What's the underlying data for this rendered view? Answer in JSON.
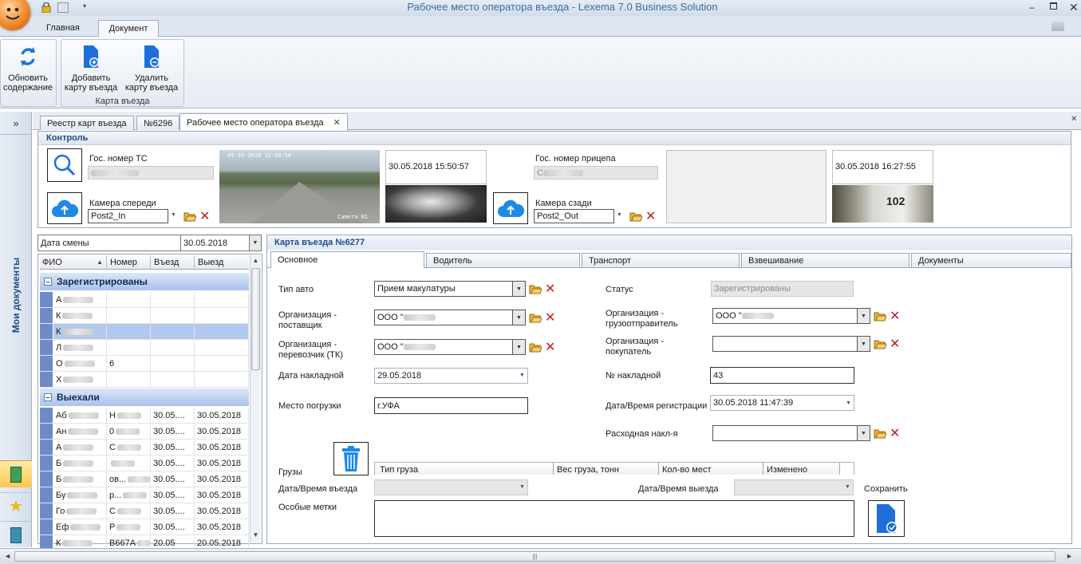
{
  "window": {
    "title": "Рабочее место оператора въезда - Lexema 7.0 Business Solution"
  },
  "ribbon": {
    "tabs": [
      "Главная",
      "Документ"
    ],
    "refresh": [
      "Обновить",
      "содержание"
    ],
    "add_card": [
      "Добавить",
      "карту въезда"
    ],
    "del_card": [
      "Удалить",
      "карту въезда"
    ],
    "group": "Карта въезда"
  },
  "side": {
    "expand": "»",
    "label": "Мои документы"
  },
  "doc_tabs": [
    "Реестр карт въезда",
    "№6296",
    "Рабочее место оператора въезда"
  ],
  "control": {
    "header": "Контроль",
    "front_plate_label": "Гос. номер ТС",
    "front_cam_label": "Камера спереди",
    "front_cam_value": "Post2_In",
    "front_ts": "30.05.2018 15:50:57",
    "trailer_label": "Гос. номер прицепа",
    "trailer_value": "С",
    "rear_cam_label": "Камера сзади",
    "rear_cam_value": "Post2_Out",
    "rear_ts": "30.05.2018 16:27:55",
    "cam_overlay": "05-30-2018 15:50:58",
    "cam_name": "Camera 01",
    "plate_text": "102"
  },
  "shift": {
    "label": "Дата смены",
    "value": "30.05.2018"
  },
  "grid": {
    "columns": [
      "ФИО",
      "Номер",
      "Въезд",
      "Выезд"
    ],
    "groups": [
      {
        "name": "Зарегистрированы",
        "rows": [
          [
            "А",
            "",
            "",
            ""
          ],
          [
            "К",
            "",
            "",
            ""
          ],
          [
            "К",
            "",
            "",
            ""
          ],
          [
            "Л",
            "",
            "",
            ""
          ],
          [
            "О",
            "6",
            "",
            ""
          ],
          [
            "Х",
            "",
            "",
            ""
          ]
        ]
      },
      {
        "name": "Выехали",
        "rows": [
          [
            "Аб",
            "Н",
            "30.05....",
            "30.05.2018"
          ],
          [
            "Ан",
            "0",
            "30.05....",
            "30.05.2018"
          ],
          [
            "А",
            "С",
            "30.05....",
            "30.05.2018"
          ],
          [
            "Б",
            "",
            "30.05....",
            "30.05.2018"
          ],
          [
            "Б",
            "ов...",
            "30.05....",
            "30.05.2018"
          ],
          [
            "Бу",
            "р...",
            "30.05....",
            "30.05.2018"
          ],
          [
            "Го",
            "С",
            "30.05....",
            "30.05.2018"
          ],
          [
            "Еф",
            "Р",
            "30.05....",
            "30.05.2018"
          ],
          [
            "К",
            "В667А",
            "20.05",
            "20.05.2018"
          ]
        ]
      }
    ]
  },
  "card": {
    "header": "Карта въезда №6277",
    "tabs": [
      "Основное",
      "Водитель",
      "Транспорт",
      "Взвешивание",
      "Документы"
    ],
    "auto_type_label": "Тип авто",
    "auto_type_value": "Прием макулатуры",
    "status_label": "Статус",
    "status_value": "Зарегистрированы",
    "supplier_label": [
      "Организация -",
      "поставщик"
    ],
    "supplier_value": "ООО \"",
    "shipper_label": [
      "Организация -",
      "грузоотправитель"
    ],
    "shipper_value": "ООО \"",
    "carrier_label": [
      "Организация -",
      "перевозчик (ТК)"
    ],
    "carrier_value": "ООО \"",
    "buyer_label": [
      "Организация -",
      "покупатель"
    ],
    "waybill_date_label": "Дата накладной",
    "waybill_date_value": "29.05.2018",
    "waybill_no_label": "№ накладной",
    "waybill_no_value": "43",
    "loading_label": "Место погрузки",
    "loading_value": "г.УФА",
    "reg_label": "Дата/Время регистрации",
    "reg_value": "30.05.2018 11:47:39",
    "expense_label": "Расходная накл-я",
    "cargo_label": "Грузы",
    "cargo_columns": [
      "Тип груза",
      "Вес груза, тонн",
      "Кол-во мест",
      "Изменено"
    ],
    "entry_label": "Дата/Время въезда",
    "exit_label": "Дата/Время выезда",
    "marks_label": "Особые метки",
    "save_label": "Сохранить"
  },
  "colors": {
    "accent": "#1e6fd9",
    "title": "#3a6ea8",
    "delete": "#c0201c"
  }
}
